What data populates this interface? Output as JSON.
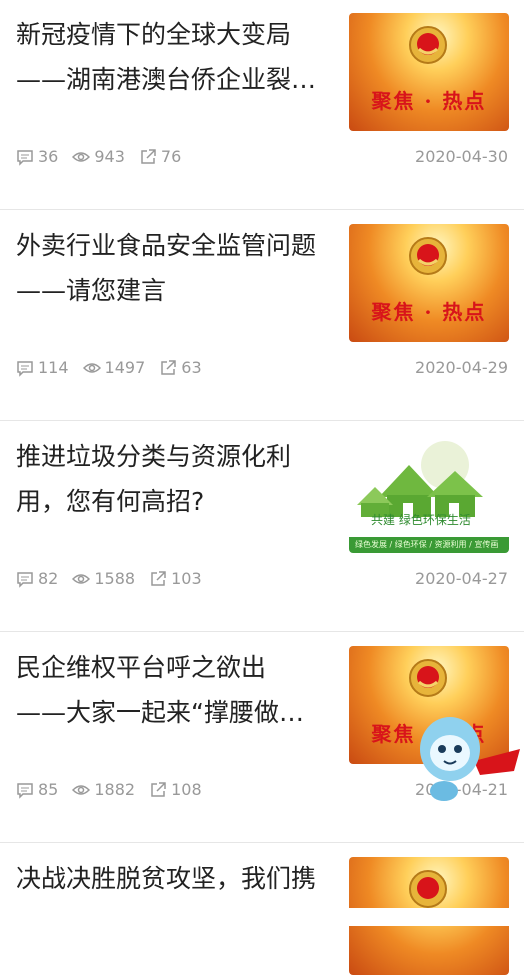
{
  "articles": [
    {
      "title_line1": "新冠疫情下的全球大变局",
      "title_line2": "——湖南港澳台侨企业裂…",
      "comments": "36",
      "views": "943",
      "shares": "76",
      "date": "2020-04-30",
      "thumb_text": "聚焦 · 热点"
    },
    {
      "title_line1": "外卖行业食品安全监管问题",
      "title_line2": "——请您建言",
      "comments": "114",
      "views": "1497",
      "shares": "63",
      "date": "2020-04-29",
      "thumb_text": "聚焦 · 热点"
    },
    {
      "title_line1": "推进垃圾分类与资源化利",
      "title_line2": "用，您有何高招?",
      "comments": "82",
      "views": "1588",
      "shares": "103",
      "date": "2020-04-27",
      "thumb_text": "共建 绿色环保生活",
      "thumb_band": "绿色发展 / 绿色环保 / 资源利用 / 宣传画"
    },
    {
      "title_line1": "民企维权平台呼之欲出",
      "title_line2": "——大家一起来“撑腰做…",
      "comments": "85",
      "views": "1882",
      "shares": "108",
      "date": "2020-04-21",
      "thumb_text": "聚焦 · 热点"
    },
    {
      "title_line1": "决战决胜脱贫攻坚，我们携",
      "title_line2": ""
    }
  ],
  "colors": {
    "accent": "#1a8fe8",
    "meta_text": "#999999",
    "focus_red": "#d8141a"
  },
  "icons": {
    "comment": "comment-icon",
    "view": "eye-icon",
    "share": "share-icon"
  }
}
